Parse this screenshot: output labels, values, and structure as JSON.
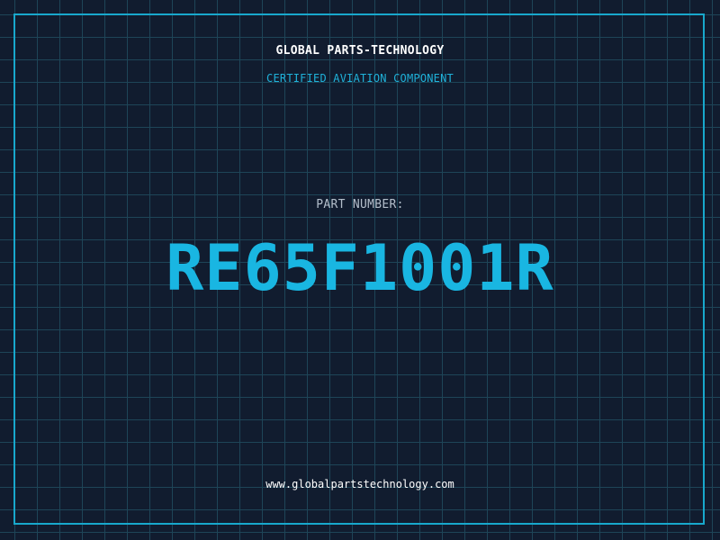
{
  "header": {
    "company": "GLOBAL PARTS-TECHNOLOGY",
    "subtitle": "CERTIFIED AVIATION COMPONENT"
  },
  "part": {
    "label": "PART NUMBER:",
    "number": "RE65F1001R"
  },
  "footer": {
    "website": "www.globalpartstechnology.com"
  },
  "colors": {
    "background": "#111c2f",
    "grid": "#1e4558",
    "accent": "#19b6e2",
    "frame": "#18a8cc"
  }
}
